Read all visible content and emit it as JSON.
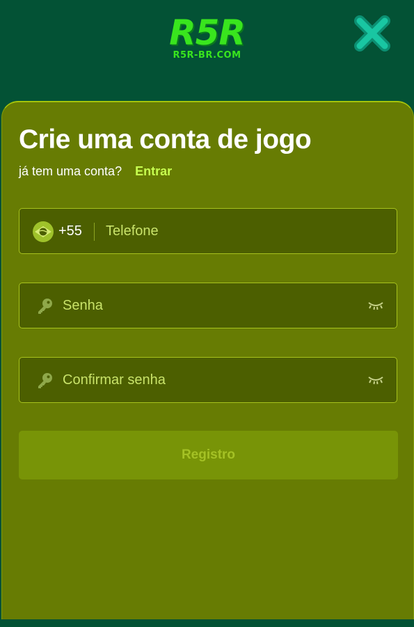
{
  "header": {
    "logo_main": "R5R",
    "logo_sub": "R5R-BR.COM"
  },
  "form": {
    "title": "Crie uma conta de jogo",
    "have_account_text": "já tem uma conta?",
    "login_link": "Entrar",
    "phone": {
      "country_code": "+55",
      "placeholder": "Telefone",
      "value": ""
    },
    "password": {
      "placeholder": "Senha",
      "value": ""
    },
    "confirm_password": {
      "placeholder": "Confirmar senha",
      "value": ""
    },
    "submit_label": "Registro"
  },
  "icons": {
    "close": "close-icon",
    "flag": "brazil-flag-icon",
    "key": "key-icon",
    "eye": "eye-closed-icon"
  },
  "colors": {
    "header_bg": "#035235",
    "panel_bg": "#677c03",
    "field_bg": "#4c5f00",
    "field_border": "#a7c21d",
    "accent_link": "#c7ff4f",
    "logo_green": "#39e51e",
    "button_bg": "#789407"
  }
}
